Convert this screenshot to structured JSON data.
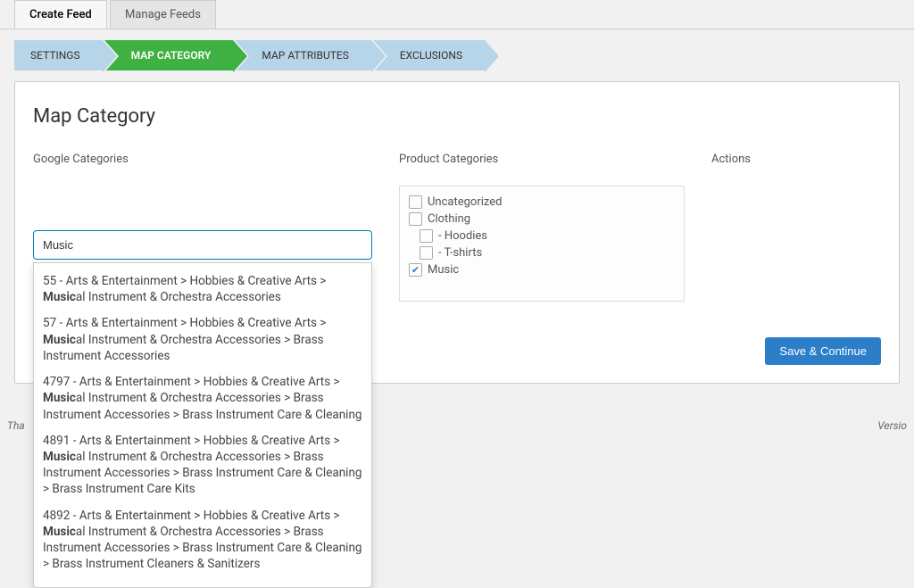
{
  "tabs": {
    "create": "Create Feed",
    "manage": "Manage Feeds"
  },
  "steps": {
    "settings": "SETTINGS",
    "map_category": "MAP CATEGORY",
    "map_attributes": "MAP ATTRIBUTES",
    "exclusions": "EXCLUSIONS"
  },
  "page": {
    "title": "Map Category",
    "google_label": "Google Categories",
    "product_label": "Product Categories",
    "actions_label": "Actions",
    "search_value": "Music"
  },
  "autocomplete": {
    "items": [
      {
        "prefix": "55 - Arts & Entertainment > Hobbies & Creative Arts > ",
        "bold": "Music",
        "suffix": "al Instrument & Orchestra Accessories"
      },
      {
        "prefix": "57 - Arts & Entertainment > Hobbies & Creative Arts > ",
        "bold": "Music",
        "suffix": "al Instrument & Orchestra Accessories > Brass Instrument Accessories"
      },
      {
        "prefix": "4797 - Arts & Entertainment > Hobbies & Creative Arts > ",
        "bold": "Music",
        "suffix": "al Instrument & Orchestra Accessories > Brass Instrument Accessories > Brass Instrument Care & Cleaning"
      },
      {
        "prefix": "4891 - Arts & Entertainment > Hobbies & Creative Arts > ",
        "bold": "Music",
        "suffix": "al Instrument & Orchestra Accessories > Brass Instrument Accessories > Brass Instrument Care & Cleaning > Brass Instrument Care Kits"
      },
      {
        "prefix": "4892 - Arts & Entertainment > Hobbies & Creative Arts > ",
        "bold": "Music",
        "suffix": "al Instrument & Orchestra Accessories > Brass Instrument Accessories > Brass Instrument Care & Cleaning > Brass Instrument Cleaners & Sanitizers"
      }
    ]
  },
  "categories": [
    {
      "label": "Uncategorized",
      "checked": false,
      "indent": 0
    },
    {
      "label": "Clothing",
      "checked": false,
      "indent": 0
    },
    {
      "label": "- Hoodies",
      "checked": false,
      "indent": 1
    },
    {
      "label": "- T-shirts",
      "checked": false,
      "indent": 1
    },
    {
      "label": "Music",
      "checked": true,
      "indent": 0
    }
  ],
  "buttons": {
    "save": "Save & Continue"
  },
  "footer": {
    "left": "Tha",
    "right": "Versio"
  }
}
